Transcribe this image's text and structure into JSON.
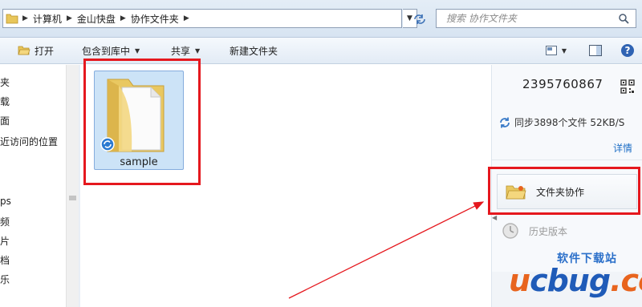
{
  "address": {
    "crumbs": [
      "计算机",
      "金山快盘",
      "协作文件夹"
    ],
    "search_placeholder": "搜索 协作文件夹"
  },
  "toolbar": {
    "open": "打开",
    "include_library": "包含到库中",
    "share": "共享",
    "new_folder": "新建文件夹"
  },
  "nav": {
    "items": [
      "夹",
      "载",
      "面",
      "近访问的位置",
      "ps",
      "频",
      "片",
      "档",
      "乐"
    ]
  },
  "files": [
    {
      "name": "sample",
      "icon": "folder-sync-icon"
    }
  ],
  "right_pane": {
    "account": "2395760867",
    "sync_status": "同步3898个文件 52KB/S",
    "detail_link": "详情",
    "folder_collab_button": "文件夹协作",
    "history_label": "历史版本"
  },
  "watermark": {
    "cn_text": "软件下载站",
    "logo_u": "u",
    "logo_c": "c",
    "logo_bug": "bug",
    "logo_cc": ".cc"
  },
  "colors": {
    "highlight_red": "#e5181e",
    "link_blue": "#1f6fc6",
    "selection": "#cce3f7"
  }
}
